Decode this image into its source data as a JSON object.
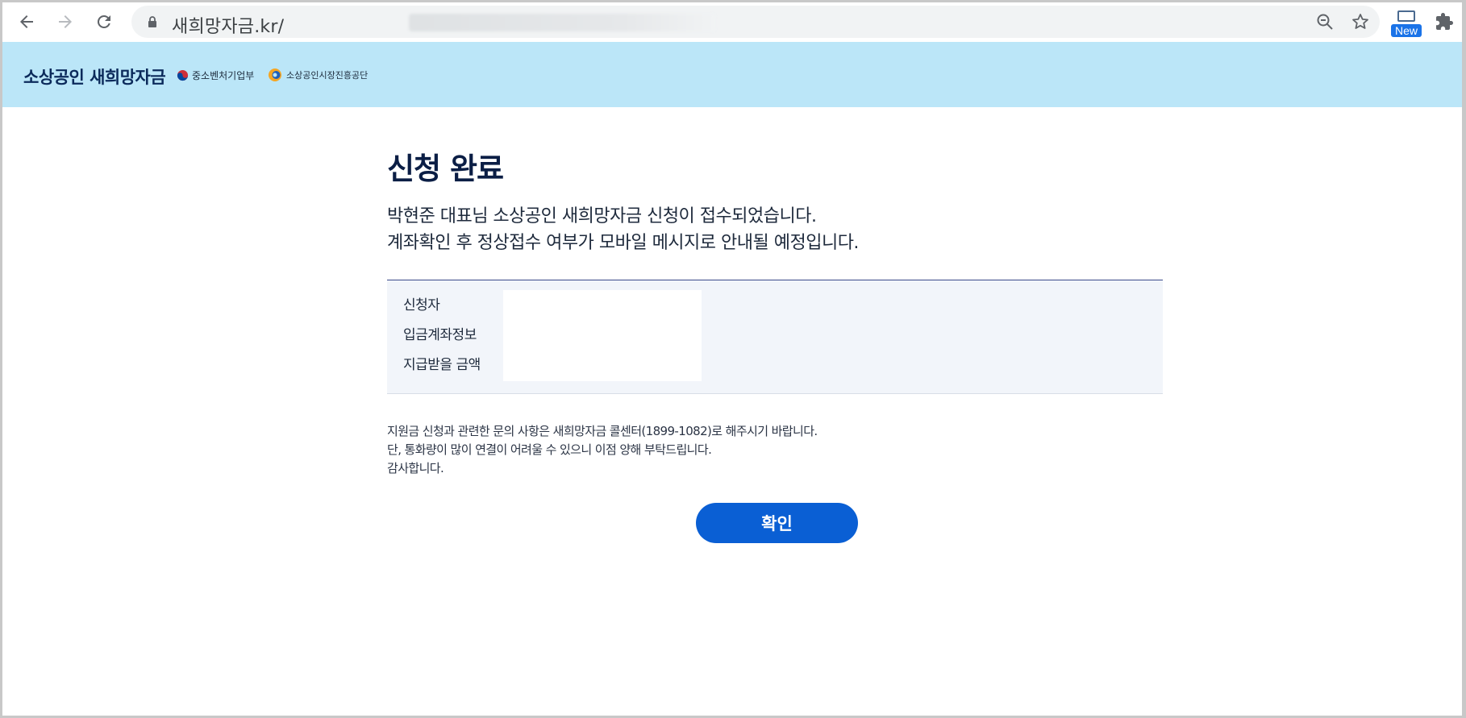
{
  "browser": {
    "url": "새희망자금.kr/",
    "new_badge": "New"
  },
  "header": {
    "logo": "소상공인 새희망자금",
    "ministry": "중소벤처기업부",
    "agency": "소상공인시장진흥공단"
  },
  "main": {
    "title": "신청 완료",
    "message_line1": "박현준 대표님 소상공인 새희망자금 신청이 접수되었습니다.",
    "message_line2": "계좌확인 후 정상접수 여부가 모바일 메시지로 안내될 예정입니다.",
    "info": {
      "applicant_label": "신청자",
      "account_label": "입금계좌정보",
      "amount_label": "지급받을 금액"
    },
    "notice_line1": "지원금 신청과 관련한 문의 사항은 새희망자금 콜센터(1899-1082)로 해주시기 바랍니다.",
    "notice_line2": "단, 통화량이 많이 연결이 어려울 수 있으니 이점 양해 부탁드립니다.",
    "notice_line3": "감사합니다.",
    "confirm_label": "확인"
  },
  "colors": {
    "header_bg": "#bbe6f8",
    "title_color": "#0b1e45",
    "button_bg": "#0a5fd4",
    "info_bg": "#f2f5fa"
  }
}
